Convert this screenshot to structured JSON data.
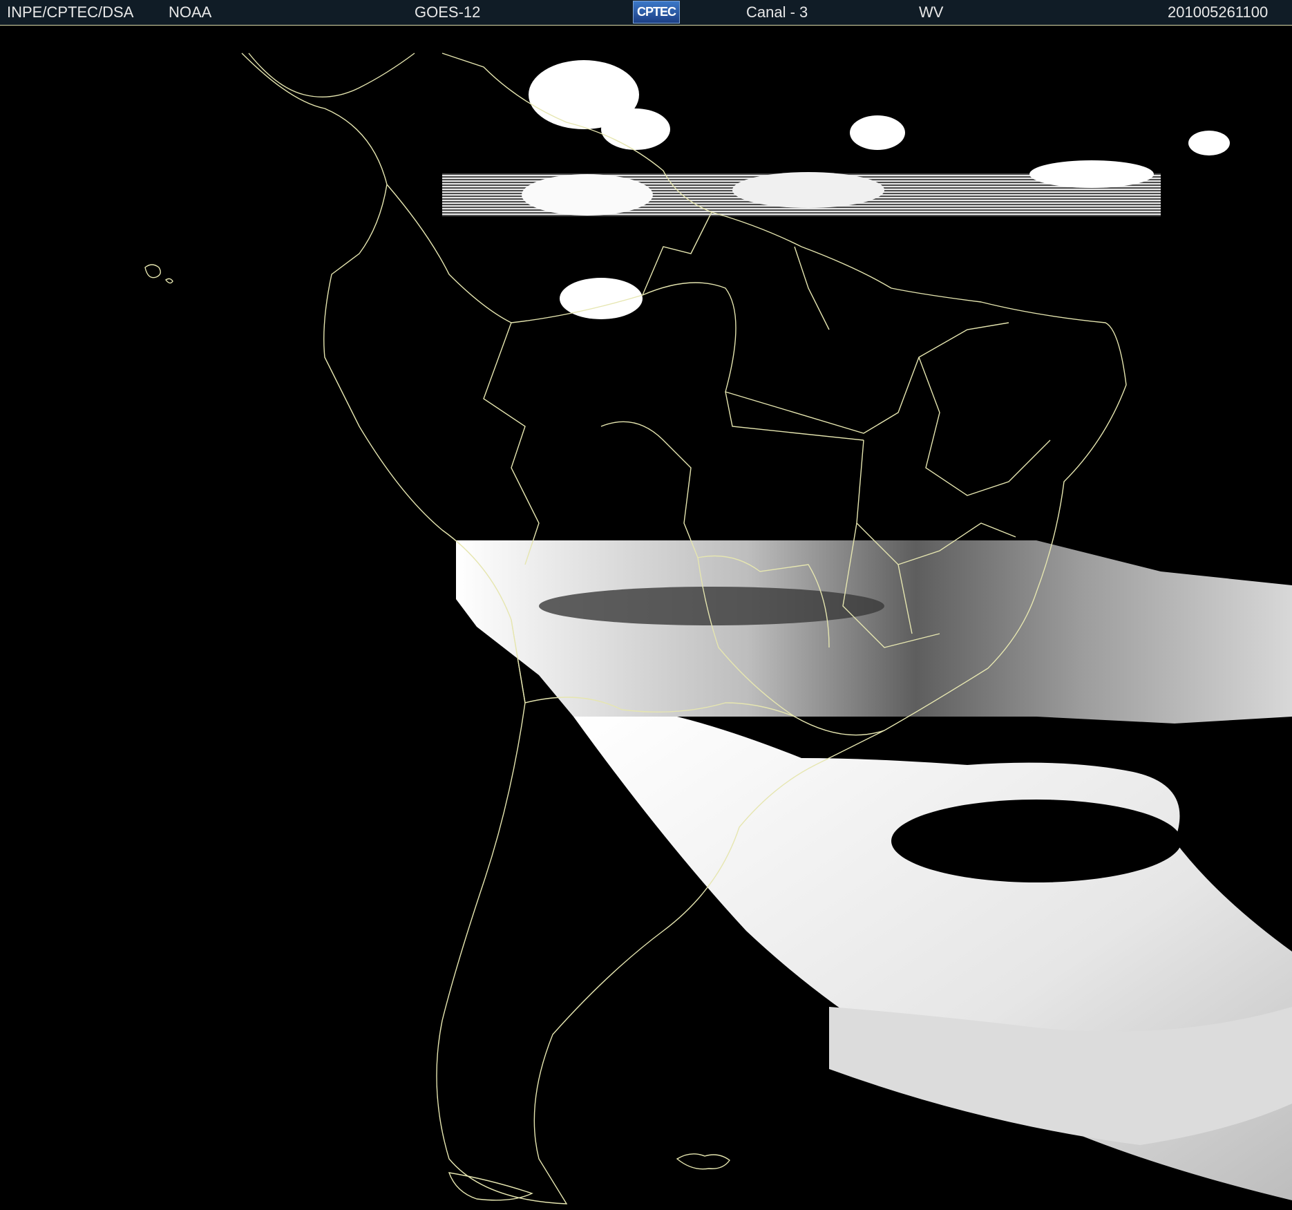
{
  "header": {
    "org": "INPE/CPTEC/DSA",
    "agency": "NOAA",
    "satellite": "GOES-12",
    "logo_text": "CPTEC",
    "channel": "Canal - 3",
    "band": "WV",
    "timestamp": "201005261100"
  },
  "colors": {
    "header_bg": "#101c26",
    "header_text": "#e8e8e8",
    "borders": "#e6e6b0",
    "background": "#000000",
    "cloud_bright": "#ffffff",
    "cloud_gray": "#9a9a9a"
  },
  "map": {
    "projection": "satellite water vapor imagery over South America",
    "layers": [
      "cloud-imagery",
      "coastline",
      "country-borders",
      "state-borders"
    ]
  }
}
